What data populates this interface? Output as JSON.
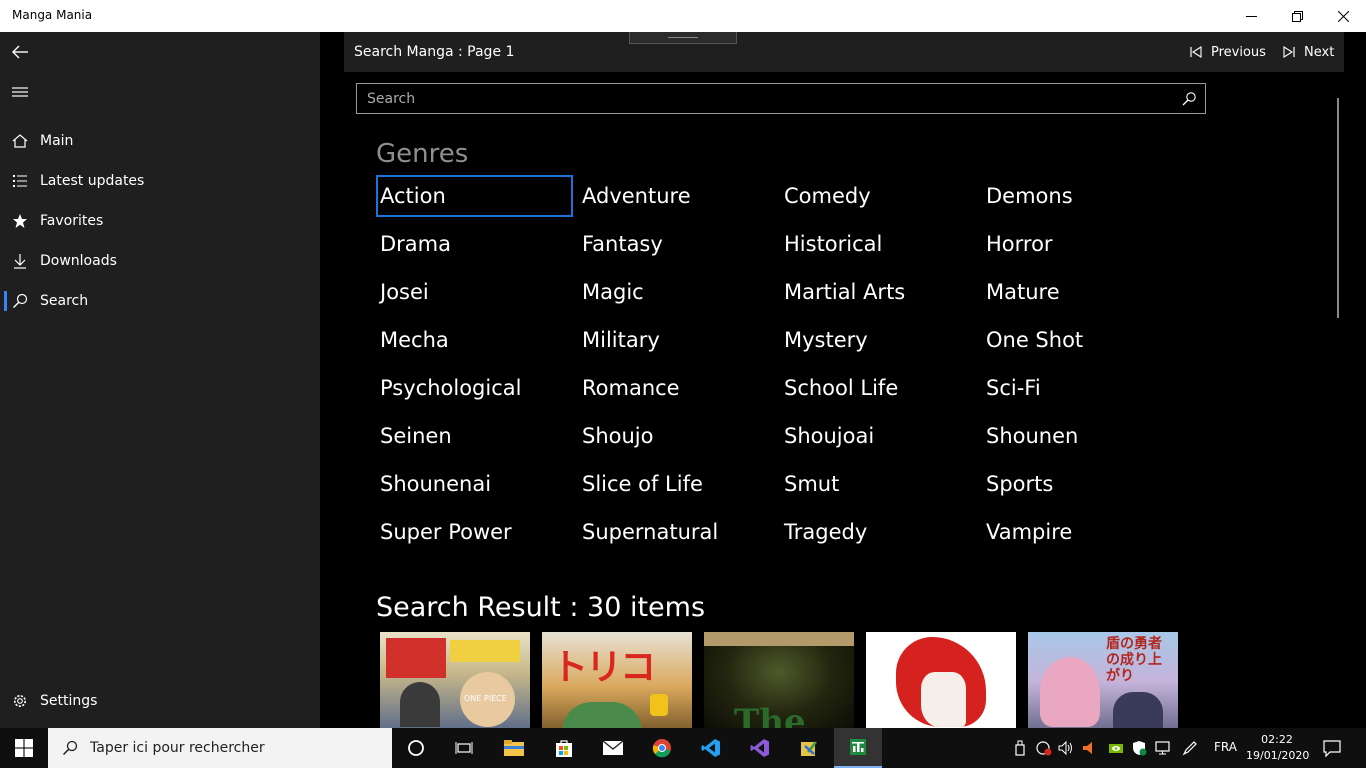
{
  "window": {
    "title": "Manga Mania"
  },
  "sidebar": {
    "items": [
      {
        "label": "Main",
        "icon": "home-icon"
      },
      {
        "label": "Latest updates",
        "icon": "list-icon"
      },
      {
        "label": "Favorites",
        "icon": "star-icon"
      },
      {
        "label": "Downloads",
        "icon": "download-icon"
      },
      {
        "label": "Search",
        "icon": "search-icon",
        "selected": true
      }
    ],
    "settings_label": "Settings"
  },
  "topbar": {
    "page_title": "Search Manga : Page 1",
    "previous_label": "Previous",
    "next_label": "Next"
  },
  "search": {
    "placeholder": "Search",
    "value": ""
  },
  "genres": {
    "title": "Genres",
    "items": [
      "Action",
      "Adventure",
      "Comedy",
      "Demons",
      "Drama",
      "Fantasy",
      "Historical",
      "Horror",
      "Josei",
      "Magic",
      "Martial Arts",
      "Mature",
      "Mecha",
      "Military",
      "Mystery",
      "One Shot",
      "Psychological",
      "Romance",
      "School Life",
      "Sci-Fi",
      "Seinen",
      "Shoujo",
      "Shoujoai",
      "Shounen",
      "Shounenai",
      "Slice of Life",
      "Smut",
      "Sports",
      "Super Power",
      "Supernatural",
      "Tragedy",
      "Vampire"
    ],
    "focused": "Action"
  },
  "results": {
    "title": "Search Result : 30 items",
    "thumbnails": [
      {
        "name": "cover-weekly-jump",
        "text": "ONE PIECE"
      },
      {
        "name": "cover-toriko",
        "text": "トリコ"
      },
      {
        "name": "cover-the",
        "text": "The"
      },
      {
        "name": "cover-red-hair",
        "text": ""
      },
      {
        "name": "cover-shield-hero",
        "text": "盾の勇者の成り上がり"
      }
    ]
  },
  "taskbar": {
    "search_placeholder": "Taper ici pour rechercher",
    "language": "FRA",
    "time": "02:22",
    "date": "19/01/2020"
  },
  "colors": {
    "accent": "#1e73d9",
    "sidebar_bg": "#1f1f1f",
    "genres_title": "#8f8f8f"
  }
}
